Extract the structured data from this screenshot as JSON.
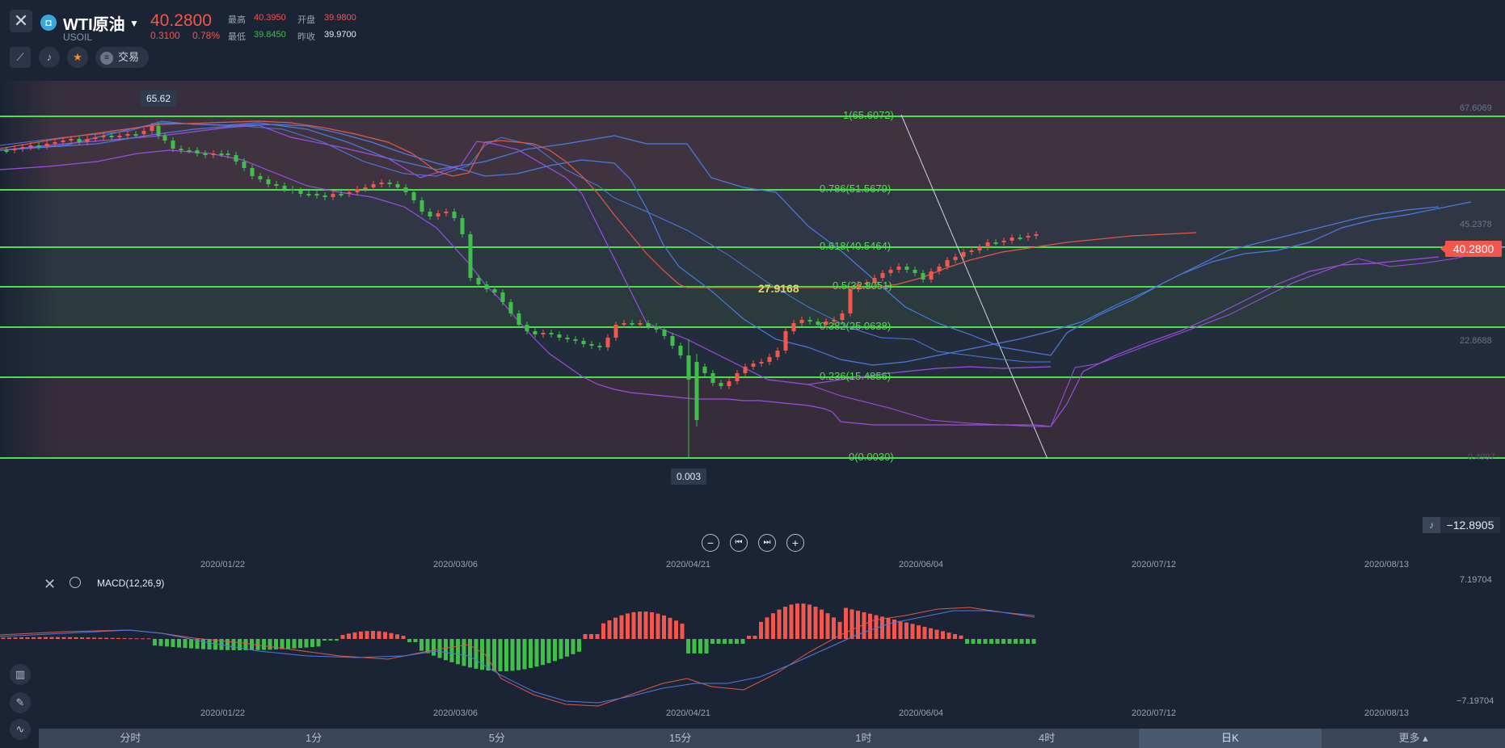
{
  "header": {
    "close_icon": "✕",
    "symbol_logo": "◘",
    "symbol_name": "WTI原油",
    "symbol_code": "USOIL",
    "price": "40.2800",
    "change": "0.3100",
    "change_pct": "0.78%",
    "stats": {
      "high_label": "最高",
      "high": "40.3950",
      "open_label": "开盘",
      "open": "39.9800",
      "low_label": "最低",
      "low": "39.8450",
      "prev_label": "昨收",
      "prev": "39.9700"
    },
    "trade_label": "交易"
  },
  "chart": {
    "price_labels": {
      "top": "67.6069",
      "mid": "45.2378",
      "low": "22.8688",
      "bottom": "0.4997"
    },
    "current_price_tag": "40.2800",
    "high_callout": "65.62",
    "low_callout": "0.003",
    "mid_price_label": "27.9168",
    "fib_levels": [
      {
        "ratio": 1,
        "label": "1(65.6072)"
      },
      {
        "ratio": 0.786,
        "label": "0.786(51.5679)"
      },
      {
        "ratio": 0.618,
        "label": "0.618(40.5464)"
      },
      {
        "ratio": 0.5,
        "label": "0.5(32.8051)"
      },
      {
        "ratio": 0.382,
        "label": "0.382(25.0638)"
      },
      {
        "ratio": 0.236,
        "label": "0.236(15.4856)"
      },
      {
        "ratio": 0,
        "label": "0(0.0030)"
      }
    ],
    "alert_value": "−12.8905",
    "x_dates": [
      "2020/01/22",
      "2020/03/06",
      "2020/04/21",
      "2020/06/04",
      "2020/07/12",
      "2020/08/13"
    ],
    "zoom_controls": [
      "−",
      "⏮",
      "⏭",
      "+"
    ]
  },
  "macd": {
    "title": "MACD(12,26,9)",
    "top_label": "7.19704",
    "bottom_label": "−7.19704"
  },
  "timeframes": [
    {
      "label": "分时",
      "active": false
    },
    {
      "label": "1分",
      "active": false
    },
    {
      "label": "5分",
      "active": false
    },
    {
      "label": "15分",
      "active": false
    },
    {
      "label": "1时",
      "active": false
    },
    {
      "label": "4时",
      "active": false
    },
    {
      "label": "日K",
      "active": true
    },
    {
      "label": "更多 ▴",
      "active": false
    }
  ],
  "colors": {
    "up": "#f2564d",
    "down": "#3fbf4a",
    "fib_line": "#4ce04c",
    "boll_upper": "#e0584a",
    "boll_mid": "#4b7be0",
    "boll_lower": "#9b4fe0"
  }
}
